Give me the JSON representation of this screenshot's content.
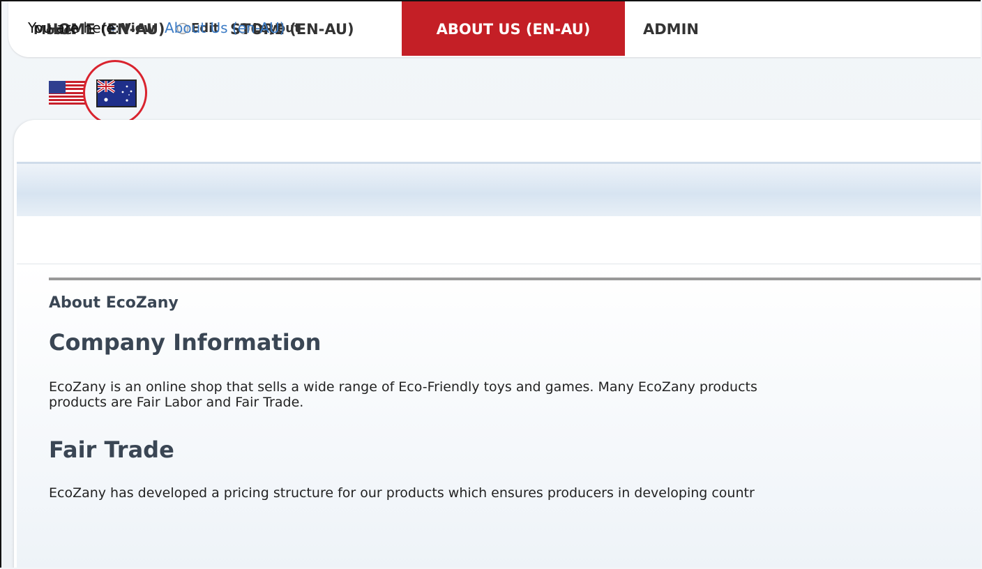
{
  "mode_bar": {
    "label": "Mode:",
    "options": [
      {
        "label": "View",
        "selected": true
      },
      {
        "label": "Edit",
        "selected": false
      },
      {
        "label": "Layout",
        "selected": false
      }
    ]
  },
  "flags": {
    "us": {
      "icon": "us-flag-icon"
    },
    "au": {
      "icon": "australia-flag-icon",
      "highlighted": true
    }
  },
  "nav": {
    "items": [
      {
        "label": "HOME (EN-AU)",
        "active": false
      },
      {
        "label": "STORE (EN-AU)",
        "active": false
      },
      {
        "label": "ABOUT US (EN-AU)",
        "active": true
      },
      {
        "label": "ADMIN",
        "active": false
      }
    ],
    "active_color": "#c41f26"
  },
  "breadcrumb": {
    "label": "You are here:",
    "link": "About Us (en-AU)"
  },
  "content": {
    "module_title": "About EcoZany",
    "heading_company": "Company Information",
    "para_company_line1": "EcoZany is an online shop that sells a wide range of Eco-Friendly toys and games. Many EcoZany products",
    "para_company_line2": "products are Fair Labor and Fair Trade.",
    "heading_fair": "Fair Trade",
    "para_fair": "EcoZany has developed a pricing structure for our products which ensures producers in developing countr"
  }
}
